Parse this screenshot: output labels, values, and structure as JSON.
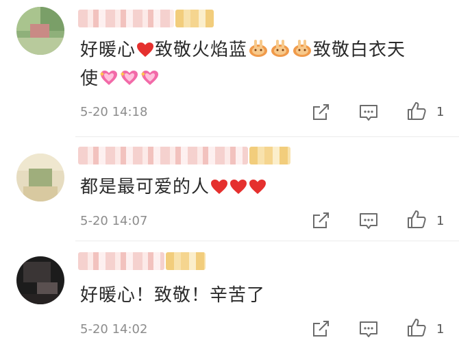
{
  "comments": [
    {
      "text_before": "好暖心",
      "text_middle": "致敬火焰蓝",
      "text_after": "致敬白衣天",
      "text_line2": "使",
      "time": "5-20 14:18",
      "likes": "1"
    },
    {
      "text": "都是最可爱的人",
      "time": "5-20 14:07",
      "likes": "1"
    },
    {
      "text": "好暖心！致敬！辛苦了",
      "time": "5-20 14:02",
      "likes": "1"
    }
  ],
  "icons": {
    "repost": "share-edit-icon",
    "comment": "comment-icon",
    "like": "thumbs-up-icon",
    "heart": "red-heart-emoji",
    "salute": "salute-emoji",
    "sparkle_heart": "sparkling-heart-emoji"
  },
  "colors": {
    "heart": "#e5302e",
    "time": "#8c8c8c",
    "text": "#2a2a2a"
  }
}
